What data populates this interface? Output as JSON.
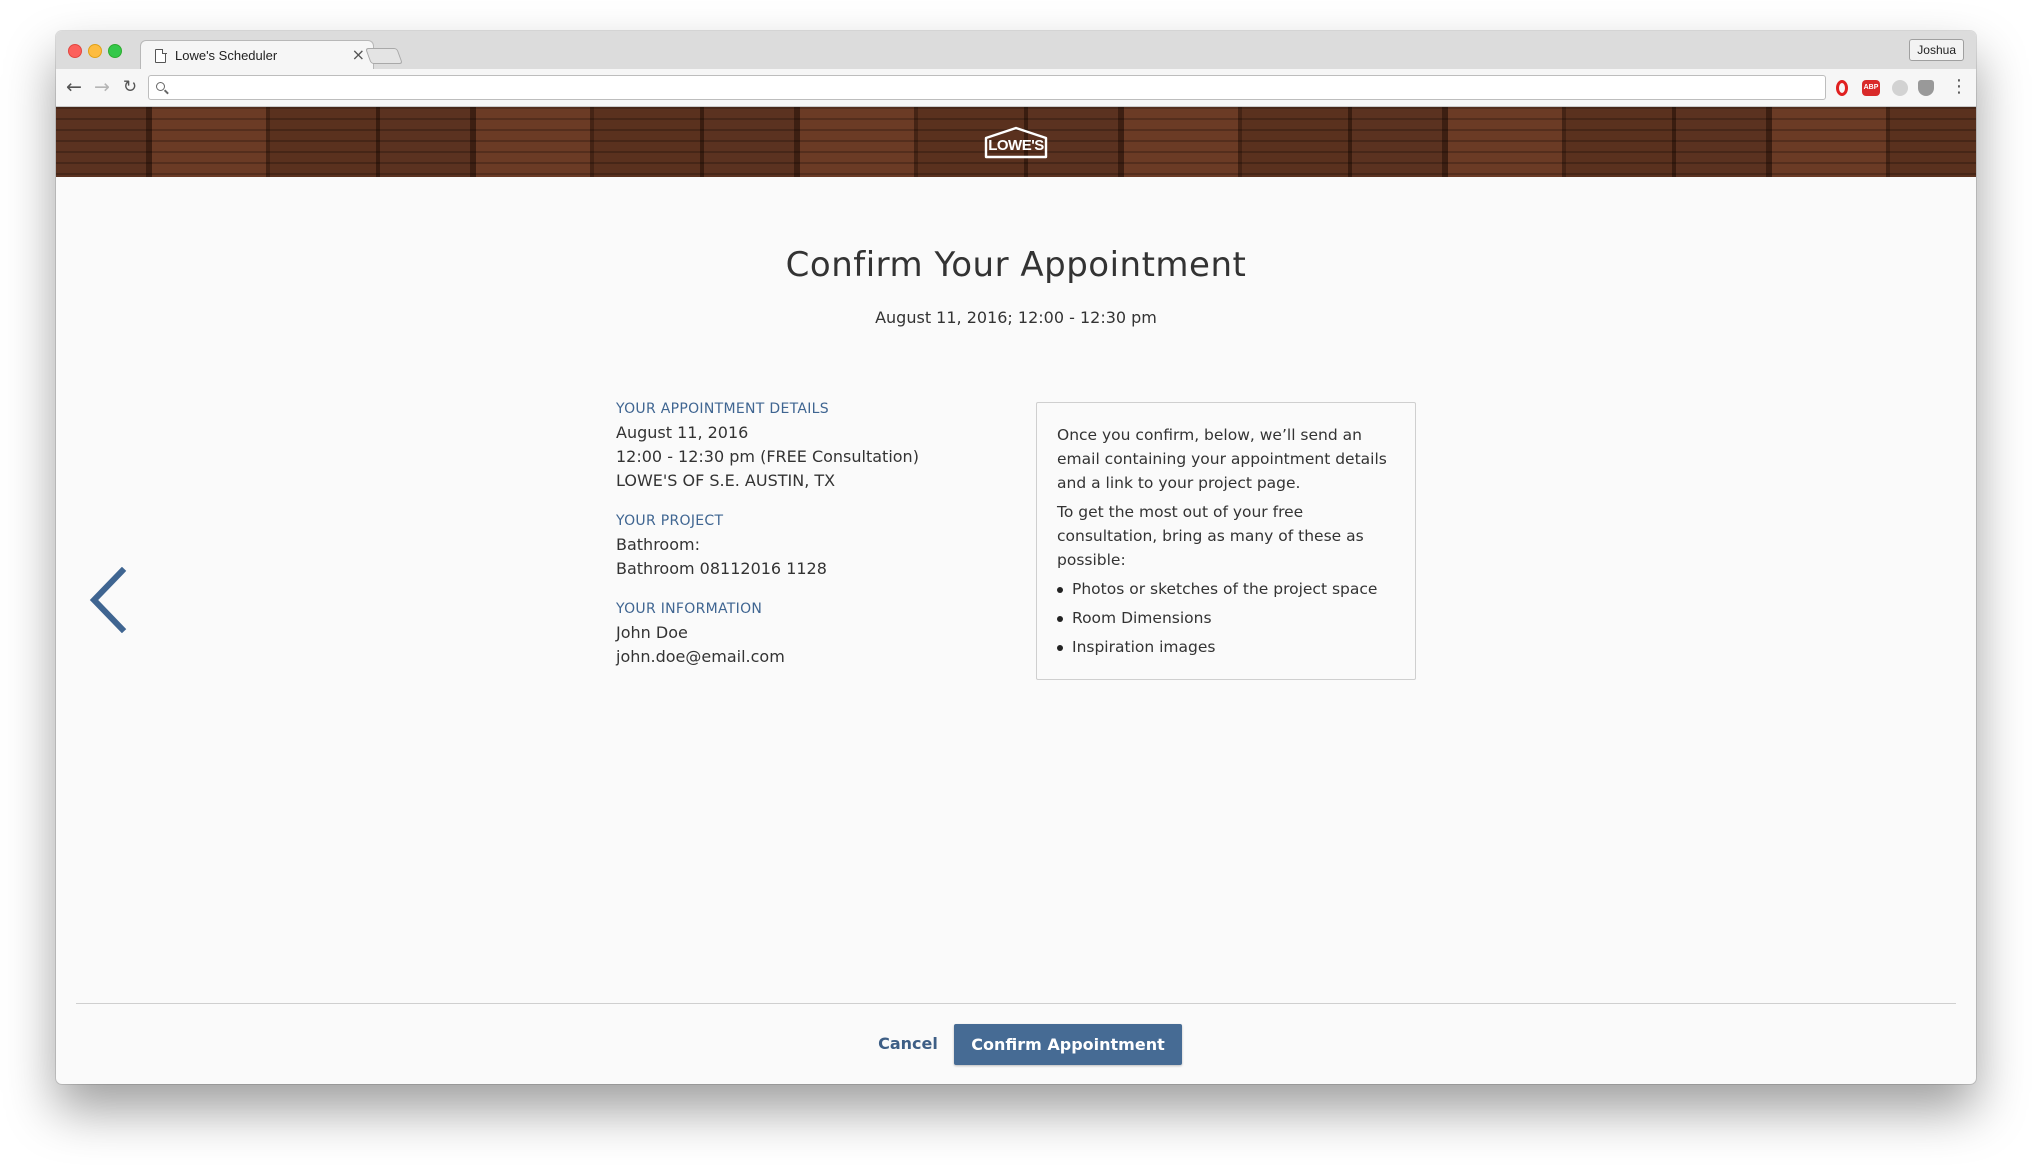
{
  "browser": {
    "tab_title": "Lowe's Scheduler",
    "tab_close": "×",
    "profile_name": "Joshua",
    "url": "",
    "icons": [
      "back-icon",
      "forward-icon",
      "reload-icon",
      "search-icon",
      "opera-icon",
      "adblock-icon",
      "extension-icon",
      "shield-icon",
      "menu-icon"
    ],
    "extensions": {
      "adblock_label": "ABP"
    }
  },
  "header": {
    "logo_text": "LOWE'S",
    "colors": {
      "wood": "#4e2a1a"
    }
  },
  "page": {
    "title": "Confirm Your Appointment",
    "subtitle": "August 11, 2016; 12:00 - 12:30 pm"
  },
  "details": {
    "appointment": {
      "heading": "YOUR APPOINTMENT DETAILS",
      "lines": [
        "August 11, 2016",
        "12:00 - 12:30 pm (FREE Consultation)",
        "LOWE'S OF S.E. AUSTIN, TX"
      ]
    },
    "project": {
      "heading": "YOUR PROJECT",
      "lines": [
        "Bathroom:",
        "Bathroom 08112016 1128"
      ]
    },
    "information": {
      "heading": "YOUR INFORMATION",
      "lines": [
        "John Doe",
        "john.doe@email.com"
      ]
    }
  },
  "info_box": {
    "paragraph1": "Once you confirm, below, we’ll send an email containing your appointment details and a link to your project page.",
    "paragraph2": "To get the most out of your free consultation, bring as many of these as possible:",
    "items": [
      "Photos or sketches of the project space",
      "Room Dimensions",
      "Inspiration images"
    ]
  },
  "footer": {
    "cancel_label": "Cancel",
    "confirm_label": "Confirm Appointment",
    "colors": {
      "primary": "#466b94",
      "link": "#3d5e85",
      "heading": "#3f6591"
    }
  }
}
